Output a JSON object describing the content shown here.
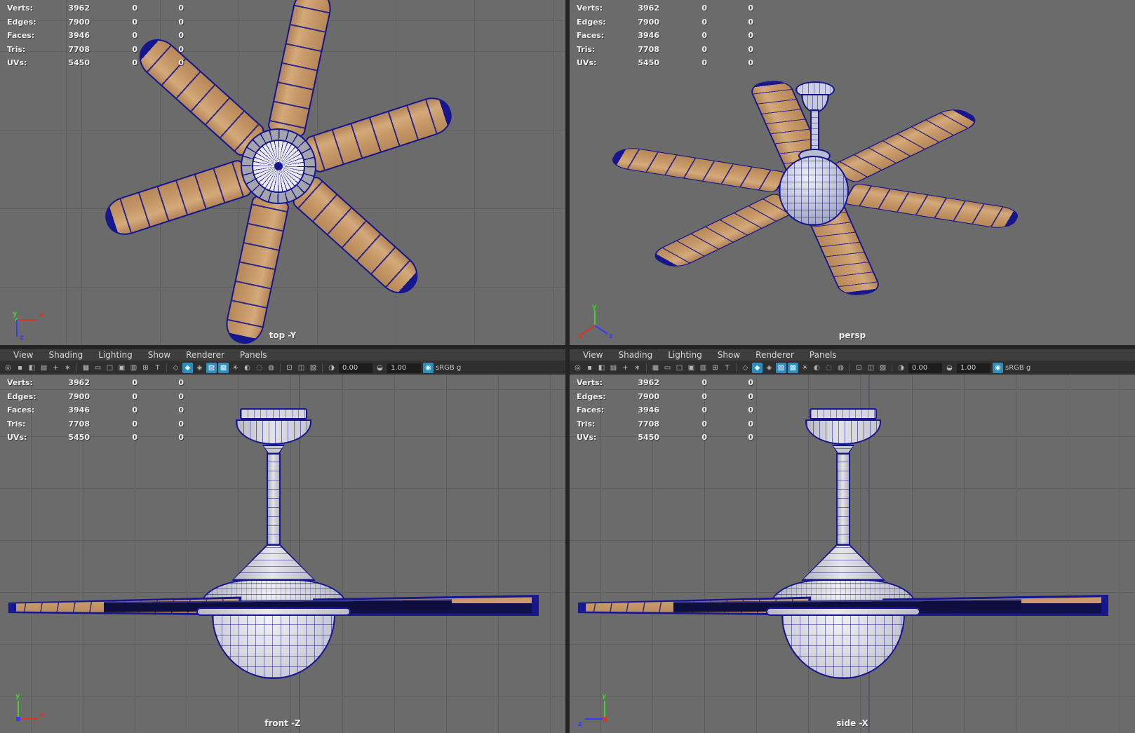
{
  "stats": {
    "rows": [
      {
        "label": "Verts:",
        "value": "3962",
        "col2": "0",
        "col3": "0"
      },
      {
        "label": "Edges:",
        "value": "7900",
        "col2": "0",
        "col3": "0"
      },
      {
        "label": "Faces:",
        "value": "3946",
        "col2": "0",
        "col3": "0"
      },
      {
        "label": "Tris:",
        "value": "7708",
        "col2": "0",
        "col3": "0"
      },
      {
        "label": "UVs:",
        "value": "5450",
        "col2": "0",
        "col3": "0"
      }
    ]
  },
  "viewports": {
    "top": {
      "label": "top -Y"
    },
    "persp": {
      "label": "persp"
    },
    "front": {
      "label": "front -Z"
    },
    "side": {
      "label": "side -X"
    }
  },
  "panel_menu": {
    "items": [
      "View",
      "Shading",
      "Lighting",
      "Show",
      "Renderer",
      "Panels"
    ]
  },
  "toolbar": {
    "items": [
      {
        "type": "icon",
        "name": "select-camera-icon",
        "glyph": "◎"
      },
      {
        "type": "icon",
        "name": "lock-camera-icon",
        "glyph": "▪"
      },
      {
        "type": "icon",
        "name": "camera-bookmark-icon",
        "glyph": "◧"
      },
      {
        "type": "icon",
        "name": "image-plane-icon",
        "glyph": "▤"
      },
      {
        "type": "icon",
        "name": "2d-pan-zoom-icon",
        "glyph": "+"
      },
      {
        "type": "icon",
        "name": "paint-select-icon",
        "glyph": "∗"
      },
      {
        "type": "sep"
      },
      {
        "type": "icon",
        "name": "grid-toggle-icon",
        "glyph": "▦"
      },
      {
        "type": "icon",
        "name": "film-gate-icon",
        "glyph": "▭"
      },
      {
        "type": "icon",
        "name": "resolution-gate-icon",
        "glyph": "□"
      },
      {
        "type": "icon",
        "name": "gate-mask-icon",
        "glyph": "▣"
      },
      {
        "type": "icon",
        "name": "field-chart-icon",
        "glyph": "▥"
      },
      {
        "type": "icon",
        "name": "safe-action-icon",
        "glyph": "⊞"
      },
      {
        "type": "icon",
        "name": "safe-title-icon",
        "glyph": "T"
      },
      {
        "type": "sep"
      },
      {
        "type": "icon",
        "name": "wireframe-icon",
        "glyph": "◇"
      },
      {
        "type": "icon",
        "name": "smooth-shade-icon",
        "glyph": "◆",
        "hl": true
      },
      {
        "type": "icon",
        "name": "wireframe-on-shaded-icon",
        "glyph": "◈"
      },
      {
        "type": "icon",
        "name": "textured-icon",
        "glyph": "▨",
        "hl": true
      },
      {
        "type": "icon",
        "name": "use-default-material-icon",
        "glyph": "▩",
        "hl": true
      },
      {
        "type": "icon",
        "name": "lights-icon",
        "glyph": "☀"
      },
      {
        "type": "icon",
        "name": "shadows-icon",
        "glyph": "◐"
      },
      {
        "type": "icon",
        "name": "ambient-occlusion-icon",
        "glyph": "◌"
      },
      {
        "type": "icon",
        "name": "motion-blur-icon",
        "glyph": "◍"
      },
      {
        "type": "sep"
      },
      {
        "type": "icon",
        "name": "isolate-select-icon",
        "glyph": "⊡"
      },
      {
        "type": "icon",
        "name": "xray-icon",
        "glyph": "◫"
      },
      {
        "type": "icon",
        "name": "plane-toggle-icon",
        "glyph": "▧"
      },
      {
        "type": "sep"
      },
      {
        "type": "icon",
        "name": "exposure-icon",
        "glyph": "◑"
      },
      {
        "type": "field",
        "name": "exposure-field",
        "value": "0.00"
      },
      {
        "type": "icon",
        "name": "gamma-icon",
        "glyph": "◒"
      },
      {
        "type": "field",
        "name": "gamma-field",
        "value": "1.00"
      },
      {
        "type": "icon",
        "name": "srgb-gamma-icon",
        "glyph": "◉",
        "hl": true
      },
      {
        "type": "label",
        "name": "colorspace-label",
        "text": "sRGB g"
      }
    ]
  },
  "axis": {
    "x": "x",
    "y": "y",
    "z": "z"
  },
  "colors": {
    "viewport_bg": "#6b6b6b",
    "grid_line": "#5e5e60",
    "wireframe": "#16168f",
    "wood": "#c89a6d",
    "toolbar_highlight": "#2a8fbd"
  }
}
